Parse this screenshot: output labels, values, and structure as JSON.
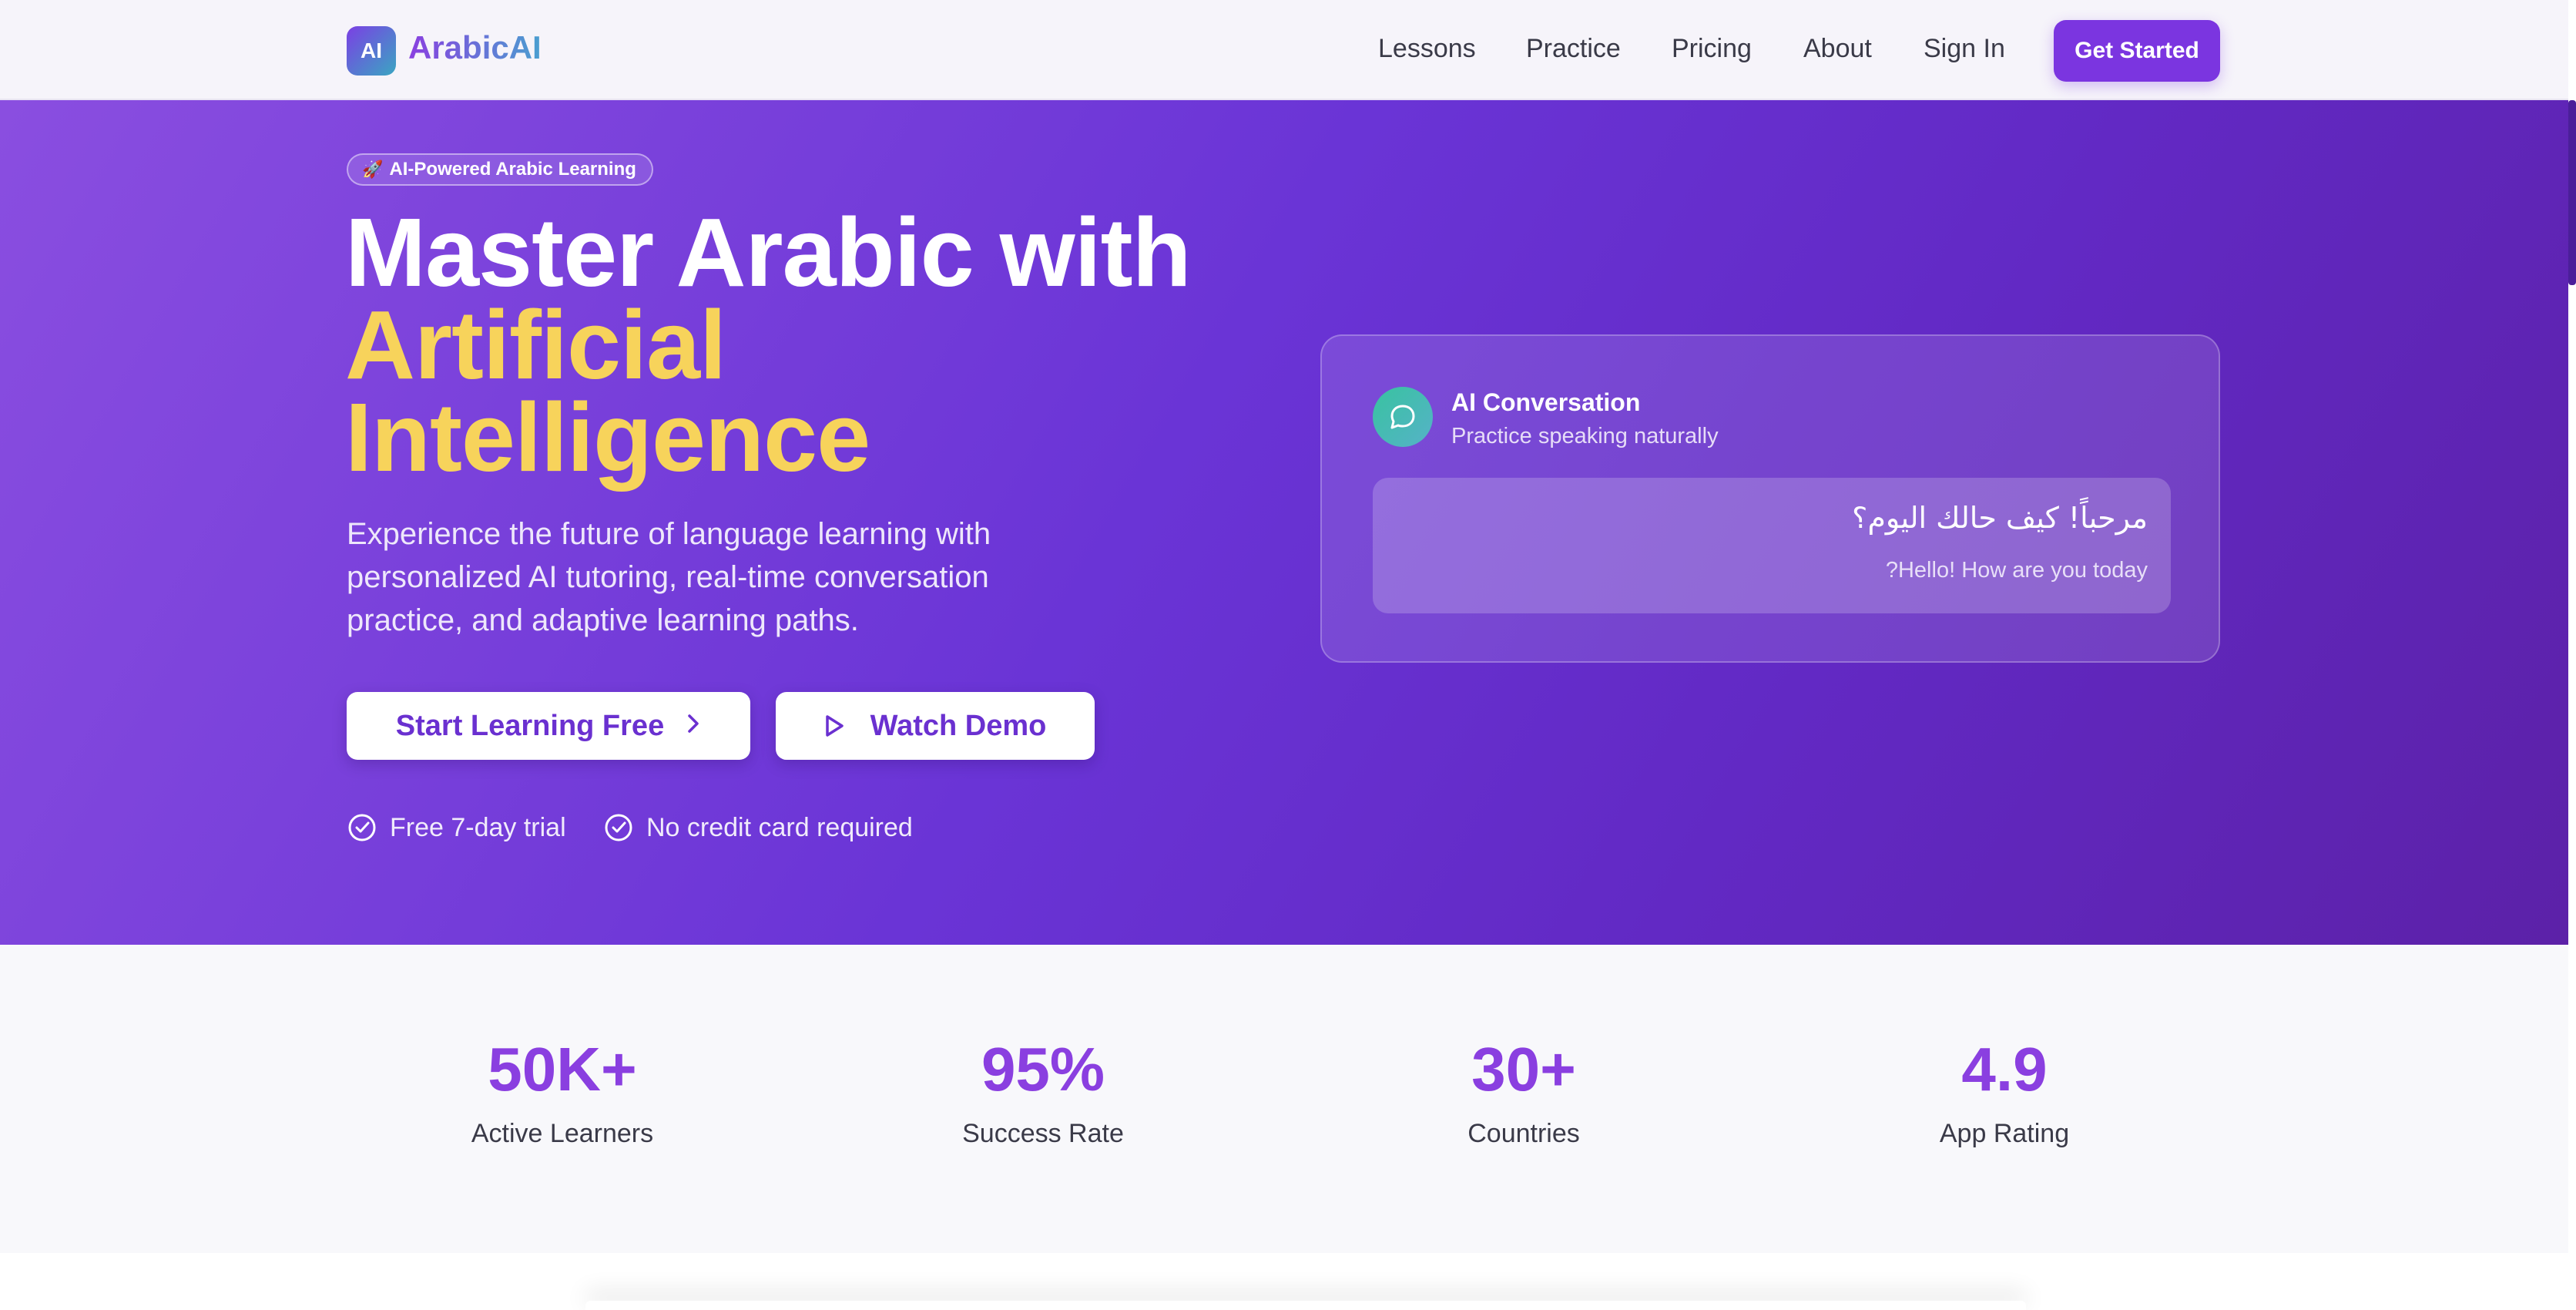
{
  "brand": {
    "logo_mark": "AI",
    "name": "ArabicAI"
  },
  "nav": {
    "links": [
      "Lessons",
      "Practice",
      "Pricing",
      "About",
      "Sign In"
    ],
    "cta": "Get Started"
  },
  "hero": {
    "badge_icon": "rocket-icon",
    "badge": "AI-Powered Arabic Learning",
    "headline_white": "Master Arabic with",
    "headline_yellow_1": "Artificial",
    "headline_yellow_2": "Intelligence",
    "subtitle": "Experience the future of language learning with personalized AI tutoring, real-time conversation practice, and adaptive learning paths.",
    "primary_button": "Start Learning Free",
    "secondary_button": "Watch Demo",
    "perks": [
      "Free 7-day trial",
      "No credit card required"
    ]
  },
  "card": {
    "title": "AI Conversation",
    "subtitle": "Practice speaking naturally",
    "arabic": "مرحباً! كيف حالك اليوم؟",
    "translation": "?Hello! How are you today"
  },
  "stats": [
    {
      "value": "50K+",
      "label": "Active Learners"
    },
    {
      "value": "95%",
      "label": "Success Rate"
    },
    {
      "value": "30+",
      "label": "Countries"
    },
    {
      "value": "4.9",
      "label": "App Rating"
    }
  ],
  "colors": {
    "accent": "#7b35e0",
    "hero_start": "#8a4ee0",
    "hero_end": "#5c21a8",
    "highlight": "#f7d35b",
    "stat_value": "#8a3fe0"
  }
}
